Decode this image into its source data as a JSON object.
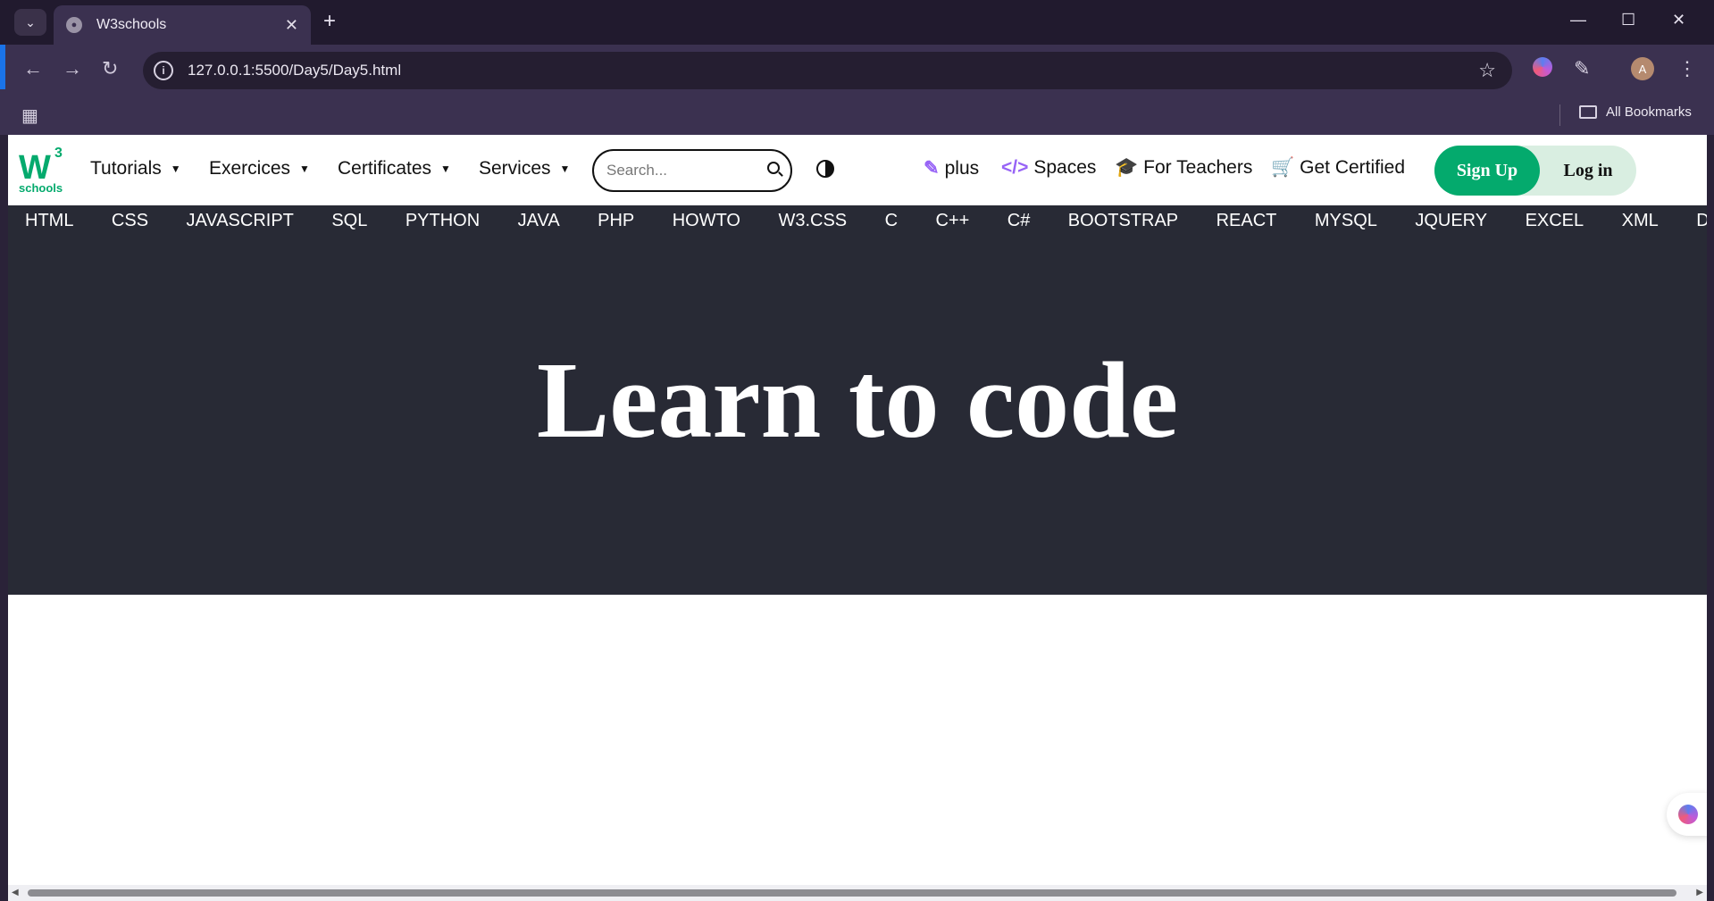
{
  "browser": {
    "tab_title": "W3schools",
    "url": "127.0.0.1:5500/Day5/Day5.html",
    "all_bookmarks": "All Bookmarks",
    "profile_initial": "A"
  },
  "header": {
    "logo_mark": "W",
    "logo_superscript": "3",
    "logo_text": "schools",
    "menus": [
      "Tutorials",
      "Exercices",
      "Certificates",
      "Services"
    ],
    "search_placeholder": "Search...",
    "links": {
      "plus": "plus",
      "spaces": "Spaces",
      "teachers": "For Teachers",
      "certified": "Get Certified"
    },
    "signup": "Sign Up",
    "login": "Log in"
  },
  "subnav": [
    "HTML",
    "CSS",
    "JAVASCRIPT",
    "SQL",
    "PYTHON",
    "JAVA",
    "PHP",
    "HOWTO",
    "W3.CSS",
    "C",
    "C++",
    "C#",
    "BOOTSTRAP",
    "REACT",
    "MYSQL",
    "JQUERY",
    "EXCEL",
    "XML",
    "DJANGO"
  ],
  "hero": {
    "title": "Learn to code"
  },
  "icons": {
    "tab_search": "chevron-down-icon",
    "favicon": "globe-icon",
    "close": "close-icon",
    "new_tab": "plus-icon",
    "back": "back-arrow-icon",
    "forward": "forward-arrow-icon",
    "reload": "reload-icon",
    "site_info": "info-icon",
    "bookmark": "star-icon",
    "extension": "puzzle-icon",
    "menu": "kebab-icon"
  },
  "colors": {
    "brand_green": "#04aa6d",
    "accent_purple": "#9763f6",
    "dark_bg": "#282a35"
  }
}
